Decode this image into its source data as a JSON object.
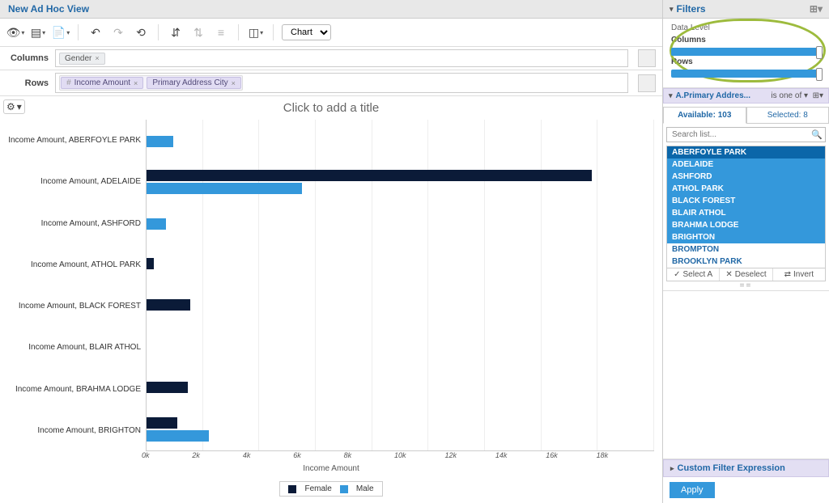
{
  "header": {
    "title": "New Ad Hoc View"
  },
  "toolbar": {
    "chart_type": "Chart"
  },
  "shelves": {
    "columns_label": "Columns",
    "rows_label": "Rows",
    "columns": [
      {
        "label": "Gender"
      }
    ],
    "rows": [
      {
        "label": "Income Amount"
      },
      {
        "label": "Primary Address City"
      }
    ]
  },
  "chart_title_placeholder": "Click to add a title",
  "legend": {
    "female": "Female",
    "male": "Male"
  },
  "xlabel": "Income Amount",
  "xticks": [
    "0k",
    "2k",
    "4k",
    "6k",
    "8k",
    "10k",
    "12k",
    "14k",
    "16k",
    "18k"
  ],
  "chart_data": {
    "type": "bar",
    "orientation": "horizontal",
    "xlabel": "Income Amount",
    "xlim": [
      0,
      18000
    ],
    "categories": [
      "Income Amount, ABERFOYLE PARK",
      "Income Amount, ADELAIDE",
      "Income Amount, ASHFORD",
      "Income Amount, ATHOL PARK",
      "Income Amount, BLACK FOREST",
      "Income Amount, BLAIR ATHOL",
      "Income Amount, BRAHMA LODGE",
      "Income Amount, BRIGHTON"
    ],
    "series": [
      {
        "name": "Female",
        "color": "#0b1b38",
        "values": [
          0,
          15800,
          0,
          250,
          1550,
          0,
          1450,
          1100
        ]
      },
      {
        "name": "Male",
        "color": "#3498db",
        "values": [
          950,
          5500,
          700,
          0,
          0,
          0,
          0,
          2200
        ]
      }
    ]
  },
  "filters_panel": {
    "title": "Filters",
    "data_level_label": "Data Level",
    "columns_label": "Columns",
    "rows_label": "Rows"
  },
  "filter": {
    "field": "A.Primary Addres...",
    "condition": "is one of",
    "available_tab": "Available: 103",
    "selected_tab": "Selected: 8",
    "search_placeholder": "Search list...",
    "options": [
      {
        "label": "ABERFOYLE PARK",
        "sel": true,
        "header": true
      },
      {
        "label": "ADELAIDE",
        "sel": true
      },
      {
        "label": "ASHFORD",
        "sel": true
      },
      {
        "label": "ATHOL PARK",
        "sel": true
      },
      {
        "label": "BLACK FOREST",
        "sel": true
      },
      {
        "label": "BLAIR ATHOL",
        "sel": true
      },
      {
        "label": "BRAHMA LODGE",
        "sel": true
      },
      {
        "label": "BRIGHTON",
        "sel": true
      },
      {
        "label": "BROMPTON",
        "sel": false
      },
      {
        "label": "BROOKLYN PARK",
        "sel": false
      }
    ],
    "select_all": "Select A",
    "deselect": "Deselect",
    "invert": "Invert"
  },
  "cfe_label": "Custom Filter Expression",
  "apply_label": "Apply"
}
